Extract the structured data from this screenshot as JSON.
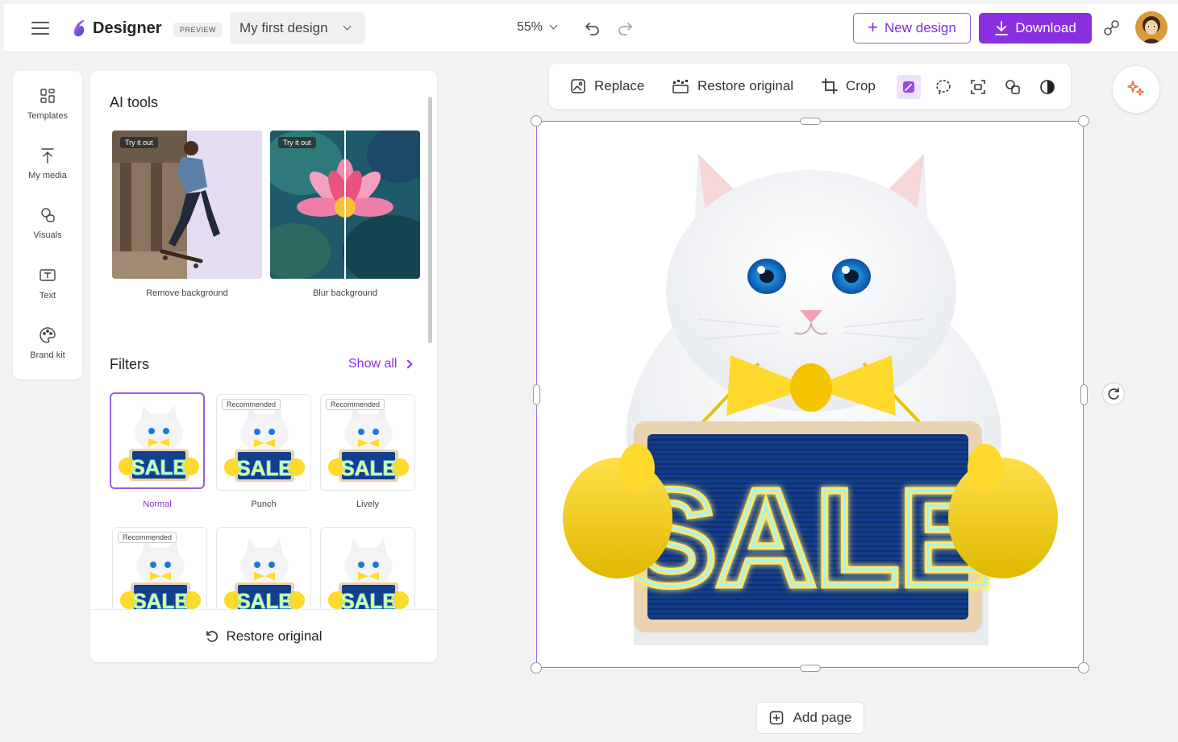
{
  "app": {
    "name": "Designer",
    "preview_badge": "PREVIEW",
    "design_name": "My first design",
    "zoom": "55%"
  },
  "header": {
    "new_design_label": "New design",
    "download_label": "Download"
  },
  "rail": {
    "items": [
      {
        "label": "Templates",
        "icon": "templates-icon"
      },
      {
        "label": "My media",
        "icon": "upload-icon"
      },
      {
        "label": "Visuals",
        "icon": "visuals-icon"
      },
      {
        "label": "Text",
        "icon": "text-icon"
      },
      {
        "label": "Brand kit",
        "icon": "palette-icon"
      }
    ]
  },
  "panel": {
    "ai_tools_title": "AI tools",
    "ai_cards": [
      {
        "badge": "Try it out",
        "label": "Remove background"
      },
      {
        "badge": "Try it out",
        "label": "Blur background"
      }
    ],
    "filters_title": "Filters",
    "show_all": "Show all",
    "filters": [
      {
        "label": "Normal",
        "badge": "",
        "selected": true
      },
      {
        "label": "Punch",
        "badge": "Recommended",
        "selected": false
      },
      {
        "label": "Lively",
        "badge": "Recommended",
        "selected": false
      },
      {
        "label": "",
        "badge": "Recommended",
        "selected": false
      },
      {
        "label": "",
        "badge": "",
        "selected": false
      },
      {
        "label": "",
        "badge": "",
        "selected": false
      }
    ],
    "restore_label": "Restore original"
  },
  "toolbar": {
    "replace_label": "Replace",
    "restore_label": "Restore original",
    "crop_label": "Crop"
  },
  "canvas": {
    "sign_text": "SALE",
    "add_page_label": "Add page"
  },
  "colors": {
    "accent": "#8a2fe0",
    "selection": "#a06ce8"
  }
}
